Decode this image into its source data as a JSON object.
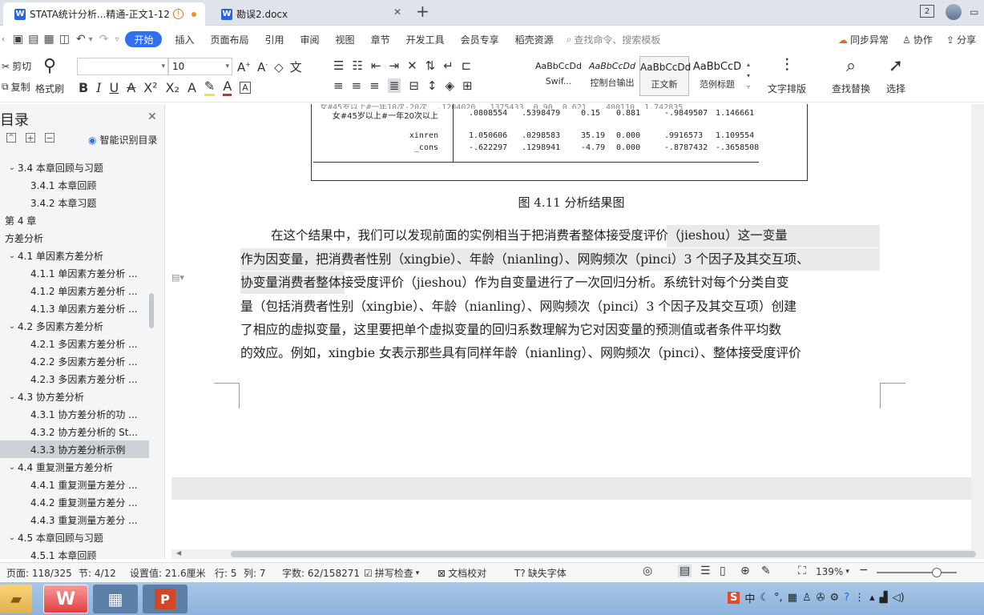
{
  "tabs": [
    {
      "label": "STATA统计分析...精通-正文1-12",
      "icon": "W",
      "active": true
    },
    {
      "label": "勘误2.docx",
      "icon": "W",
      "active": false
    }
  ],
  "tab_badge": "2",
  "menu": [
    "开始",
    "插入",
    "页面布局",
    "引用",
    "审阅",
    "视图",
    "章节",
    "开发工具",
    "会员专享",
    "稻壳资源"
  ],
  "search_placeholder": "查找命令、搜索模板",
  "menu_right": {
    "sync": "同步异常",
    "collab": "协作",
    "share": "分享"
  },
  "ribbon": {
    "cut": "剪切",
    "copy": "复制",
    "format_painter": "格式刷",
    "font_name": "",
    "font_size": "10",
    "styles": [
      {
        "preview": "AaBbCcDd",
        "label": "Swif..."
      },
      {
        "preview": "AaBbCcDd",
        "label": "控制台输出"
      },
      {
        "preview": "AaBbCcDd",
        "label": "正文新"
      },
      {
        "preview": "AaBbCcD",
        "label": "范例标题"
      }
    ],
    "text_layout": "文字排版",
    "find_replace": "查找替换",
    "select": "选择"
  },
  "sidebar": {
    "title": "目录",
    "smart_toc": "智能识别目录",
    "items": [
      {
        "label": "3.4   本章回顾与习题",
        "level": 1,
        "caret": "v"
      },
      {
        "label": "3.4.1   本章回顾",
        "level": 2,
        "caret": ""
      },
      {
        "label": "3.4.2   本章习题",
        "level": 2,
        "caret": ""
      },
      {
        "label": "第 4 章",
        "level": 0,
        "caret": ""
      },
      {
        "label": "方差分析",
        "level": 0,
        "caret": ""
      },
      {
        "label": "4.1   单因素方差分析",
        "level": 1,
        "caret": "v"
      },
      {
        "label": "4.1.1   单因素方差分析 ...",
        "level": 2,
        "caret": ""
      },
      {
        "label": "4.1.2   单因素方差分析 ...",
        "level": 2,
        "caret": ""
      },
      {
        "label": "4.1.3   单因素方差分析 ...",
        "level": 2,
        "caret": ""
      },
      {
        "label": "4.2   多因素方差分析",
        "level": 1,
        "caret": "v"
      },
      {
        "label": "4.2.1   多因素方差分析 ...",
        "level": 2,
        "caret": ""
      },
      {
        "label": "4.2.2   多因素方差分析 ...",
        "level": 2,
        "caret": ""
      },
      {
        "label": "4.2.3   多因素方差分析 ...",
        "level": 2,
        "caret": ""
      },
      {
        "label": "4.3   协方差分析",
        "level": 1,
        "caret": "v"
      },
      {
        "label": "4.3.1   协方差分析的功 ...",
        "level": 2,
        "caret": ""
      },
      {
        "label": "4.3.2   协方差分析的 St...",
        "level": 2,
        "caret": ""
      },
      {
        "label": "4.3.3   协方差分析示例",
        "level": 2,
        "caret": "",
        "selected": true
      },
      {
        "label": "4.4   重复测量方差分析",
        "level": 1,
        "caret": "v"
      },
      {
        "label": "4.4.1   重复测量方差分 ...",
        "level": 2,
        "caret": ""
      },
      {
        "label": "4.4.2   重复测量方差分 ...",
        "level": 2,
        "caret": ""
      },
      {
        "label": "4.4.3   重复测量方差分 ...",
        "level": 2,
        "caret": ""
      },
      {
        "label": "4.5   本章回顾与习题",
        "level": 1,
        "caret": "v"
      },
      {
        "label": "4.5.1   本章回顾",
        "level": 2,
        "caret": ""
      }
    ]
  },
  "table_rows": [
    {
      "label": "女#45岁以上#一年20次以上",
      "c1": ".0808554",
      "c2": ".5398479",
      "c3": "0.15",
      "c4": "0.881",
      "c5": "-.9849507",
      "c6": "1.146661"
    },
    {
      "label": "xinren",
      "c1": "1.050606",
      "c2": ".0298583",
      "c3": "35.19",
      "c4": "0.000",
      "c5": ".9916573",
      "c6": "1.109554"
    },
    {
      "label": "_cons",
      "c1": "-.622297",
      "c2": ".1298941",
      "c3": "-4.79",
      "c4": "0.000",
      "c5": "-.8787432",
      "c6": "-.3658508"
    }
  ],
  "figure_caption": "图 4.11   分析结果图",
  "paragraph_lines": [
    "在这个结果中，我们可以发现前面的实例相当于把消费者整体接受度评价（jieshou）这一变量",
    "作为因变量，把消费者性别（xingbie）、年龄（nianling）、网购频次（pinci）3 个因子及其交互项、",
    "协变量消费者整体接受度评价（jieshou）作为自变量进行了一次回归分析。系统针对每个分类自变",
    "量（包括消费者性别（xingbie）、年龄（nianling）、网购频次（pinci）3 个因子及其交互项）创建",
    "了相应的虚拟变量，这里要把单个虚拟变量的回归系数理解为它对因变量的预测值或者条件平均数",
    "的效应。例如，xingbie 女表示那些具有同样年龄（nianling）、网购频次（pinci）、整体接受度评价"
  ],
  "status": {
    "page": "页面: 118/325",
    "section": "节: 4/12",
    "setting": "设置值: 21.6厘米",
    "row": "行: 5",
    "col": "列: 7",
    "words": "字数: 62/158271",
    "spell": "拼写检查",
    "proof": "文档校对",
    "missing_font": "缺失字体",
    "zoom": "139%"
  },
  "zoom_level": 0.75,
  "colors": {
    "accent": "#2f6ff1",
    "highlight": "#dcdcdc",
    "selected_toc": "#cdd0d5",
    "taskbar": "#9cbde3"
  }
}
